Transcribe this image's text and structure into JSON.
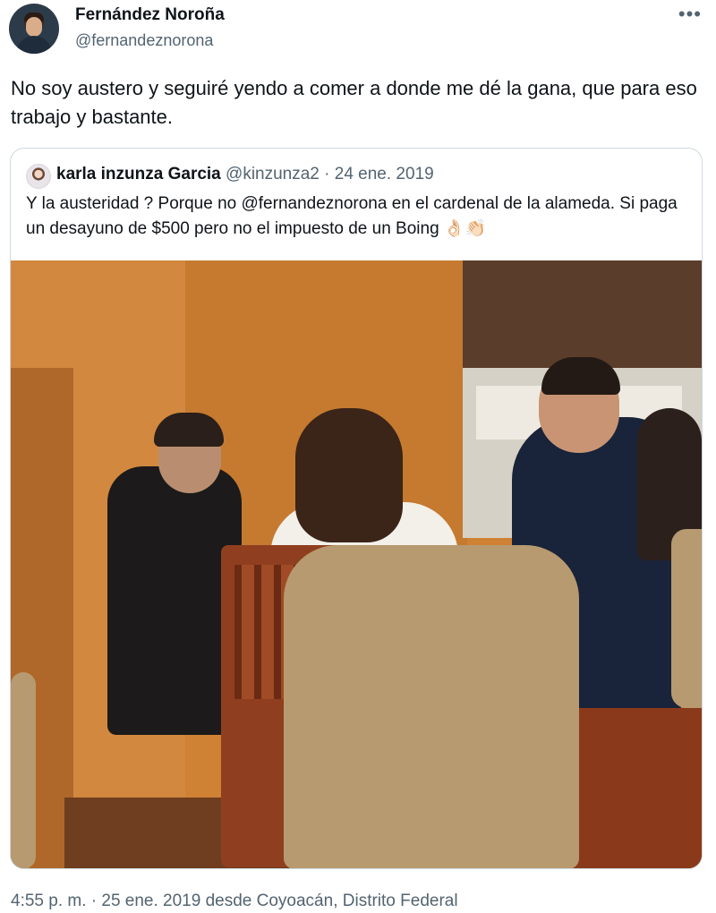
{
  "author": {
    "name": "Fernández Noroña",
    "handle": "@fernandeznorona"
  },
  "tweet": {
    "text": "No soy austero y seguiré yendo a comer a donde me dé la gana, que para eso trabajo y bastante."
  },
  "quoted": {
    "name": "karla inzunza Garcia",
    "handle": "@kinzunza2",
    "separator": "·",
    "date": "24 ene. 2019",
    "text": "Y la austeridad ? Porque no @fernandeznorona en el cardenal de la alameda. Si paga un desayuno de $500 pero no el impuesto de un Boing",
    "emojis": "👌🏻👏🏻"
  },
  "footer": {
    "text": "4:55 p. m. · 25 ene. 2019 desde Coyoacán, Distrito Federal"
  },
  "icons": [
    "more-icon",
    "ok-hand-emoji",
    "clapping-emoji"
  ],
  "colors": {
    "text": "#0f1419",
    "secondary": "#536471",
    "border": "#cfd9de",
    "wall": "#cf8134"
  }
}
